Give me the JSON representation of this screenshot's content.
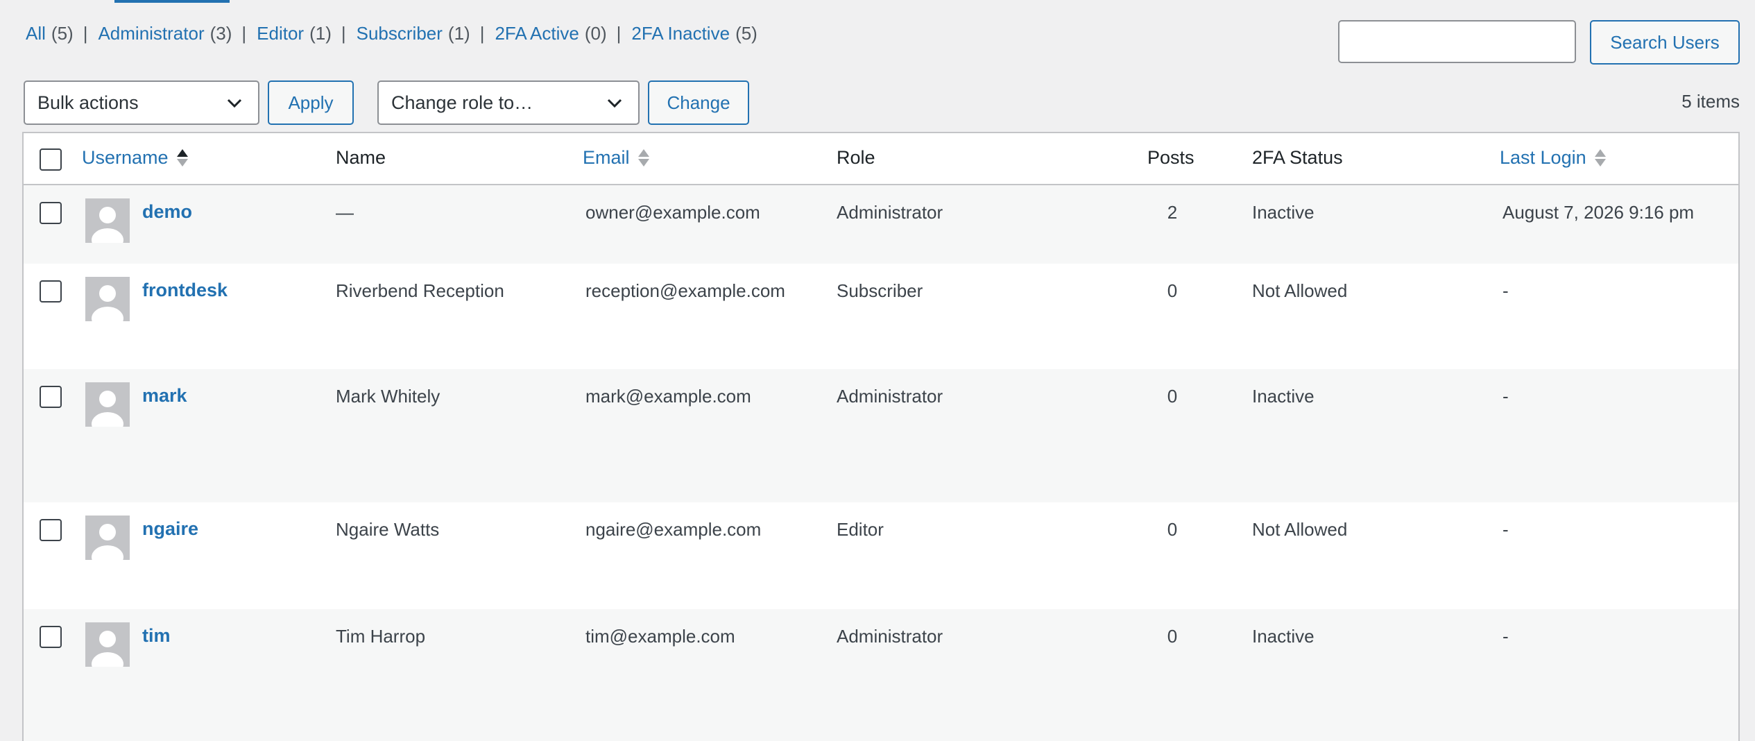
{
  "filters": [
    {
      "label": "All",
      "count": "(5)"
    },
    {
      "label": "Administrator",
      "count": "(3)"
    },
    {
      "label": "Editor",
      "count": "(1)"
    },
    {
      "label": "Subscriber",
      "count": "(1)"
    },
    {
      "label": "2FA Active",
      "count": "(0)"
    },
    {
      "label": "2FA Inactive",
      "count": "(5)"
    }
  ],
  "separator": "|",
  "search": {
    "value": "",
    "button_label": "Search Users"
  },
  "bulk_actions": {
    "selected": "Bulk actions",
    "apply_label": "Apply"
  },
  "change_role": {
    "selected": "Change role to…",
    "change_label": "Change"
  },
  "items_count": "5 items",
  "columns": {
    "username": "Username",
    "name": "Name",
    "email": "Email",
    "role": "Role",
    "posts": "Posts",
    "twofa": "2FA Status",
    "last_login": "Last Login"
  },
  "users": [
    {
      "username": "demo",
      "name": "—",
      "email": "owner@example.com",
      "role": "Administrator",
      "posts": "2",
      "twofa": "Inactive",
      "last_login": "August 7, 2026 9:16 pm"
    },
    {
      "username": "frontdesk",
      "name": "Riverbend Reception",
      "email": "reception@example.com",
      "role": "Subscriber",
      "posts": "0",
      "twofa": "Not Allowed",
      "last_login": "-"
    },
    {
      "username": "mark",
      "name": "Mark Whitely",
      "email": "mark@example.com",
      "role": "Administrator",
      "posts": "0",
      "twofa": "Inactive",
      "last_login": "-"
    },
    {
      "username": "ngaire",
      "name": "Ngaire Watts",
      "email": "ngaire@example.com",
      "role": "Editor",
      "posts": "0",
      "twofa": "Not Allowed",
      "last_login": "-"
    },
    {
      "username": "tim",
      "name": "Tim Harrop",
      "email": "tim@example.com",
      "role": "Administrator",
      "posts": "0",
      "twofa": "Inactive",
      "last_login": "-"
    }
  ]
}
